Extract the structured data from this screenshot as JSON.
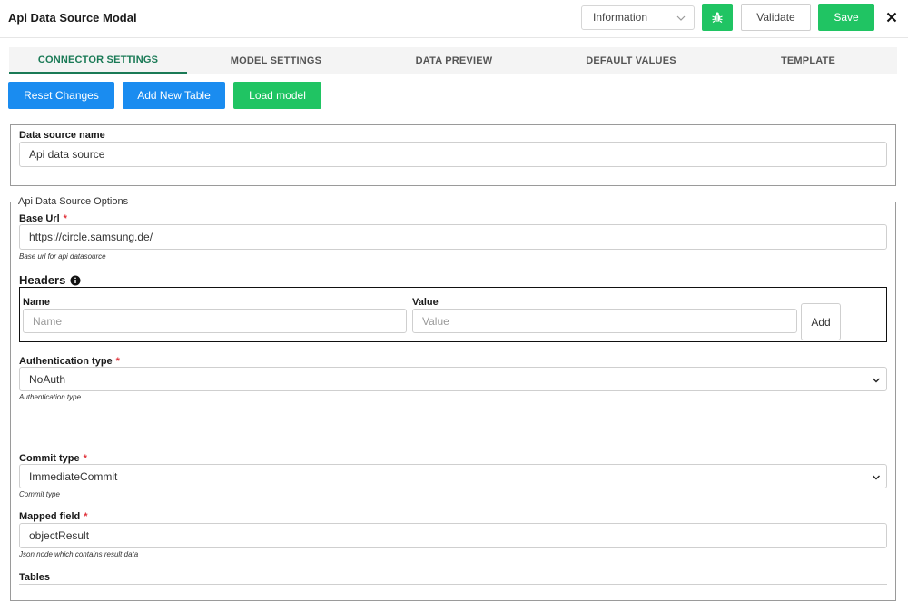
{
  "header": {
    "title": "Api Data Source Modal",
    "level_select": "Information",
    "validate_label": "Validate",
    "save_label": "Save"
  },
  "tabs": [
    {
      "label": "CONNECTOR SETTINGS",
      "active": true
    },
    {
      "label": "MODEL SETTINGS",
      "active": false
    },
    {
      "label": "DATA PREVIEW",
      "active": false
    },
    {
      "label": "DEFAULT VALUES",
      "active": false
    },
    {
      "label": "TEMPLATE",
      "active": false
    }
  ],
  "actions": {
    "reset": "Reset Changes",
    "add_table": "Add New Table",
    "load_model": "Load model"
  },
  "datasource": {
    "name_label": "Data source name",
    "name_value": "Api data source"
  },
  "api_options": {
    "legend": "Api Data Source Options",
    "base_url_label": "Base Url",
    "base_url_value": "https://circle.samsung.de/",
    "base_url_hint": "Base url for api datasource",
    "headers_label": "Headers",
    "header_name_label": "Name",
    "header_name_placeholder": "Name",
    "header_value_label": "Value",
    "header_value_placeholder": "Value",
    "add_label": "Add",
    "auth_label": "Authentication type",
    "auth_value": "NoAuth",
    "auth_hint": "Authentication type",
    "commit_label": "Commit type",
    "commit_value": "ImmediateCommit",
    "commit_hint": "Commit type",
    "mapped_label": "Mapped field",
    "mapped_value": "objectResult",
    "mapped_hint": "Json node which contains result data",
    "tables_label": "Tables"
  },
  "required_mark": "*",
  "colors": {
    "accent_green": "#20c463",
    "accent_blue": "#1a8cf0",
    "tab_active": "#1a7a56",
    "required": "#e0343c"
  },
  "icons": {
    "bug": "bug-icon",
    "close": "close-icon",
    "info": "info-icon",
    "chevron": "chevron-down-icon"
  }
}
